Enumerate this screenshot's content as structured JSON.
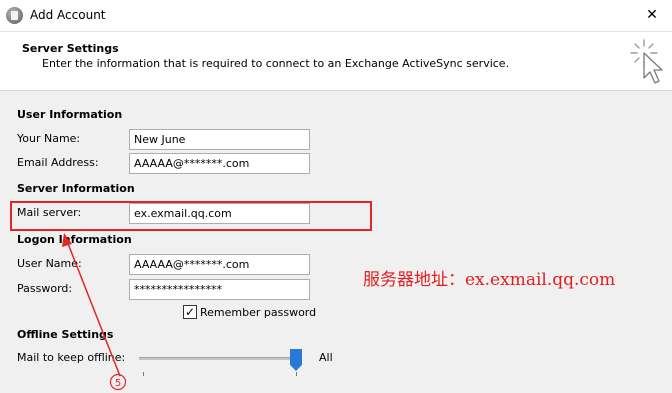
{
  "window": {
    "title": "Add Account",
    "close": "✕"
  },
  "header": {
    "title": "Server Settings",
    "description": "Enter the information that is required to connect to an Exchange ActiveSync service."
  },
  "user_information": {
    "title": "User Information",
    "name_label": "Your Name:",
    "name_value": "New June",
    "email_label": "Email Address:",
    "email_value": "AAAAA@*******.com"
  },
  "server_information": {
    "title": "Server Information",
    "mail_server_label": "Mail server:",
    "mail_server_value": "ex.exmail.qq.com"
  },
  "logon_information": {
    "title": "Logon Information",
    "user_name_label": "User Name:",
    "user_name_value": "AAAAA@*******.com",
    "password_label": "Password:",
    "password_value": "****************",
    "remember_label": "Remember password",
    "remember_checked": true
  },
  "offline_settings": {
    "title": "Offline Settings",
    "keep_offline_label": "Mail to keep offline:",
    "keep_offline_value": "All",
    "slider_level": 1.0
  },
  "annotation": {
    "server_address_note": "服务器地址：ex.exmail.qq.com",
    "step_marker": "⑤",
    "color": "#e02020"
  },
  "colors": {
    "accent": "#2a79d8",
    "annotation_red": "#e12626"
  }
}
